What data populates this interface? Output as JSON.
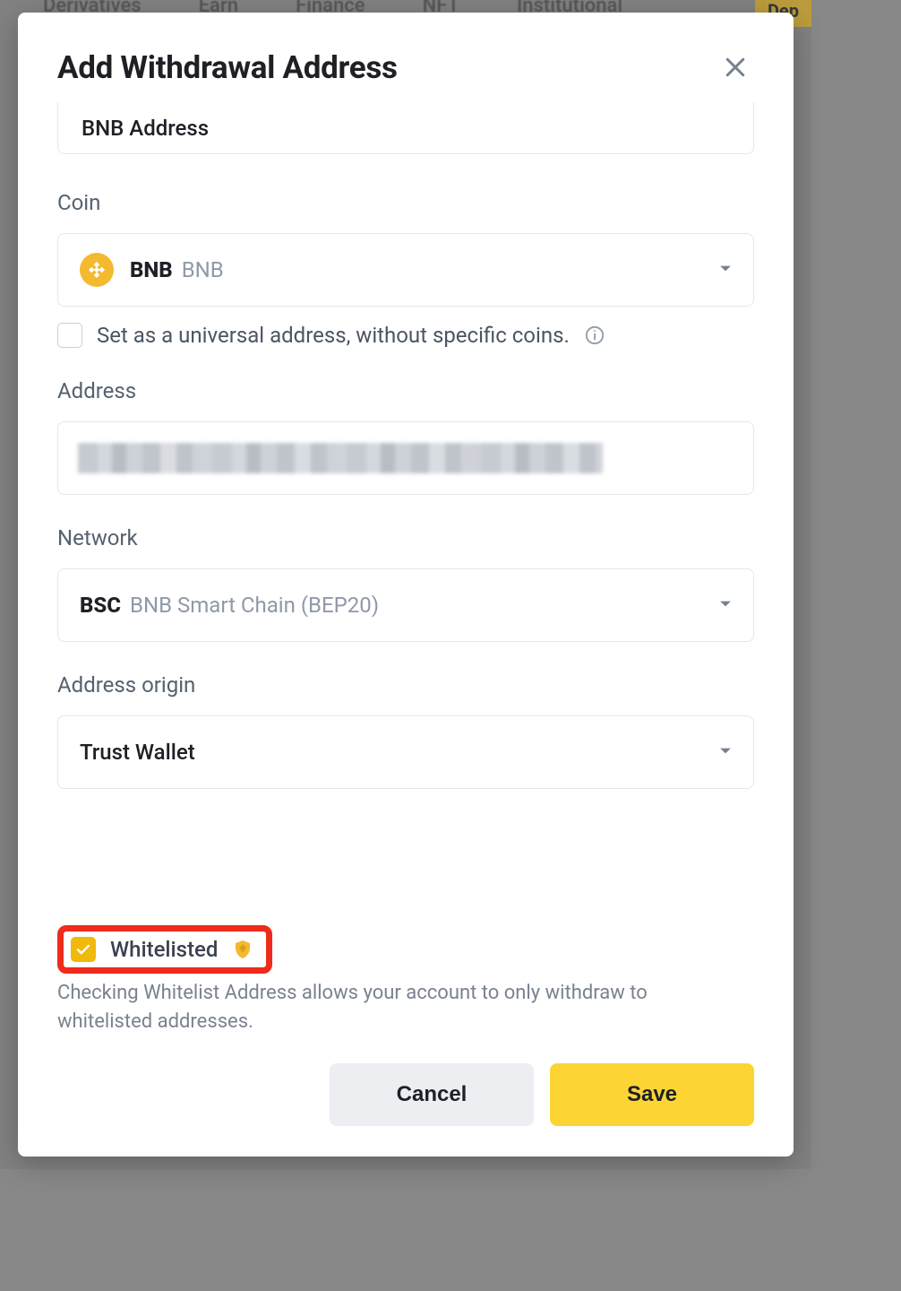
{
  "backgroundNav": [
    "Derivatives",
    "Earn",
    "Finance",
    "NFT",
    "Institutional"
  ],
  "depositBtn": "Dep",
  "modal": {
    "title": "Add Withdrawal Address",
    "labelField": {
      "value": "BNB Address"
    },
    "coin": {
      "label": "Coin",
      "symbol": "BNB",
      "name": "BNB",
      "iconName": "bnb-icon"
    },
    "universal": {
      "checked": false,
      "text": "Set as a universal address, without specific coins."
    },
    "address": {
      "label": "Address",
      "value": "██████████████████████████████"
    },
    "network": {
      "label": "Network",
      "symbol": "BSC",
      "name": "BNB Smart Chain (BEP20)"
    },
    "origin": {
      "label": "Address origin",
      "value": "Trust Wallet"
    },
    "whitelist": {
      "checked": true,
      "label": "Whitelisted",
      "help": "Checking Whitelist Address allows your account to only withdraw to whitelisted addresses."
    },
    "buttons": {
      "cancel": "Cancel",
      "save": "Save"
    }
  }
}
